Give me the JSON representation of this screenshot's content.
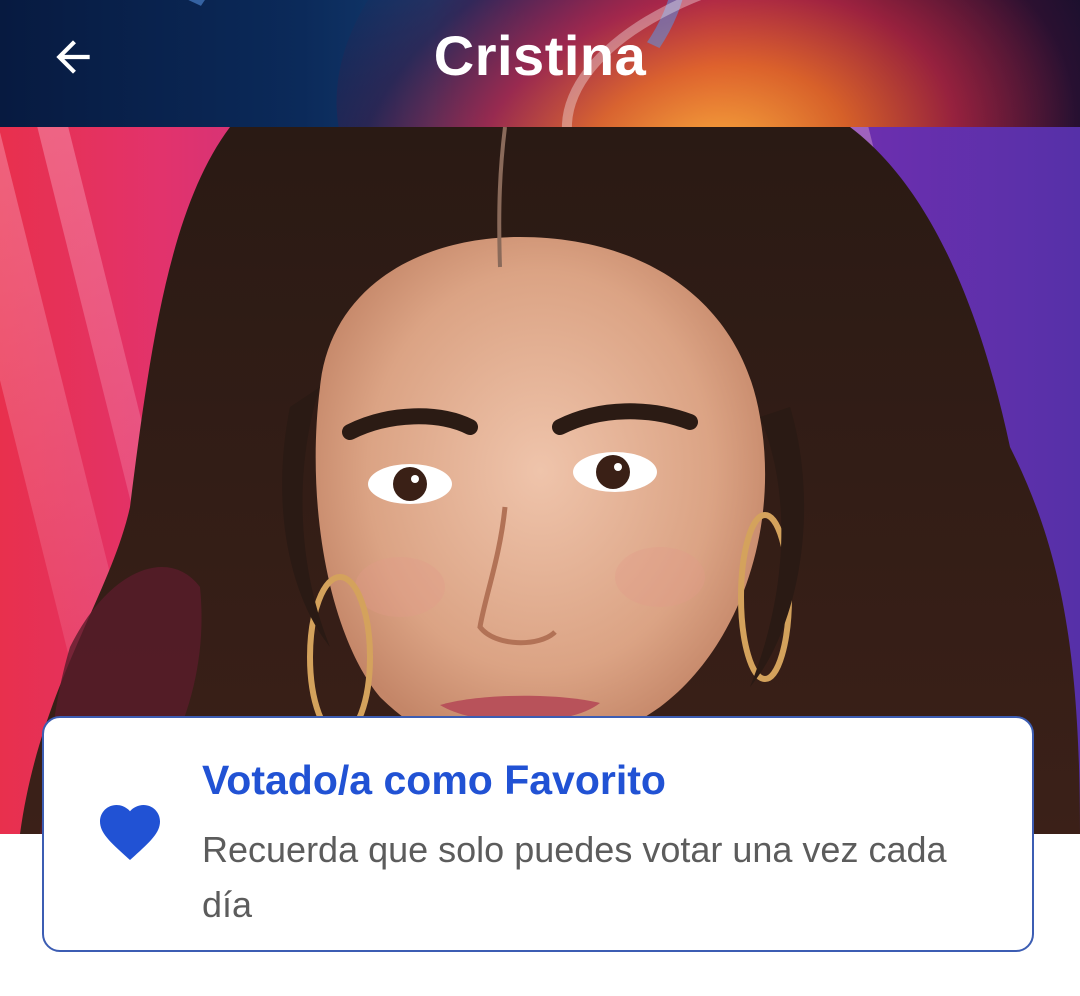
{
  "header": {
    "title": "Cristina",
    "back_icon": "arrow-left-icon"
  },
  "hero": {
    "subject": "contestant-portrait"
  },
  "vote_card": {
    "icon": "heart-icon",
    "title": "Votado/a como Favorito",
    "note": "Recuerda que solo puedes votar una vez cada día"
  },
  "colors": {
    "accent_blue": "#2152d4",
    "card_border": "#3c5db3",
    "note_text": "#5c5c5c"
  }
}
